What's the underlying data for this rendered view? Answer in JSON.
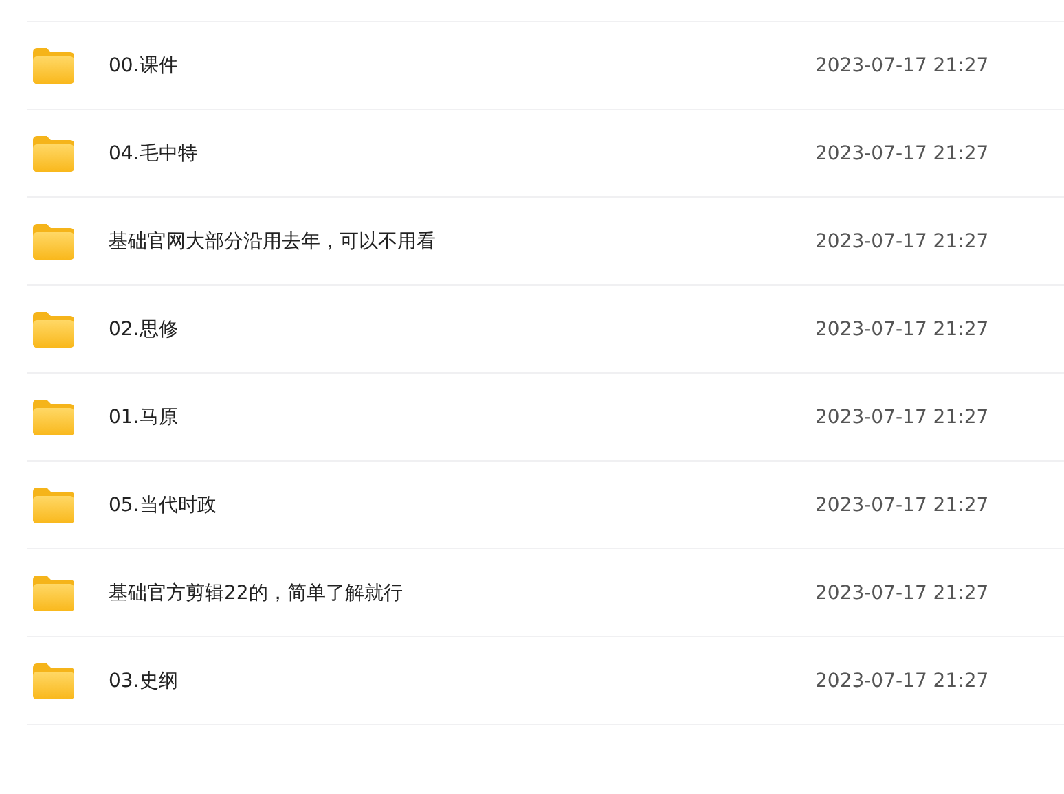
{
  "files": [
    {
      "name": "00.课件",
      "modified": "2023-07-17 21:27"
    },
    {
      "name": "04.毛中特",
      "modified": "2023-07-17 21:27"
    },
    {
      "name": "基础官网大部分沿用去年，可以不用看",
      "modified": "2023-07-17 21:27"
    },
    {
      "name": "02.思修",
      "modified": "2023-07-17 21:27"
    },
    {
      "name": "01.马原",
      "modified": "2023-07-17 21:27"
    },
    {
      "name": "05.当代时政",
      "modified": "2023-07-17 21:27"
    },
    {
      "name": "基础官方剪辑22的，简单了解就行",
      "modified": "2023-07-17 21:27"
    },
    {
      "name": "03.史纲",
      "modified": "2023-07-17 21:27"
    }
  ]
}
